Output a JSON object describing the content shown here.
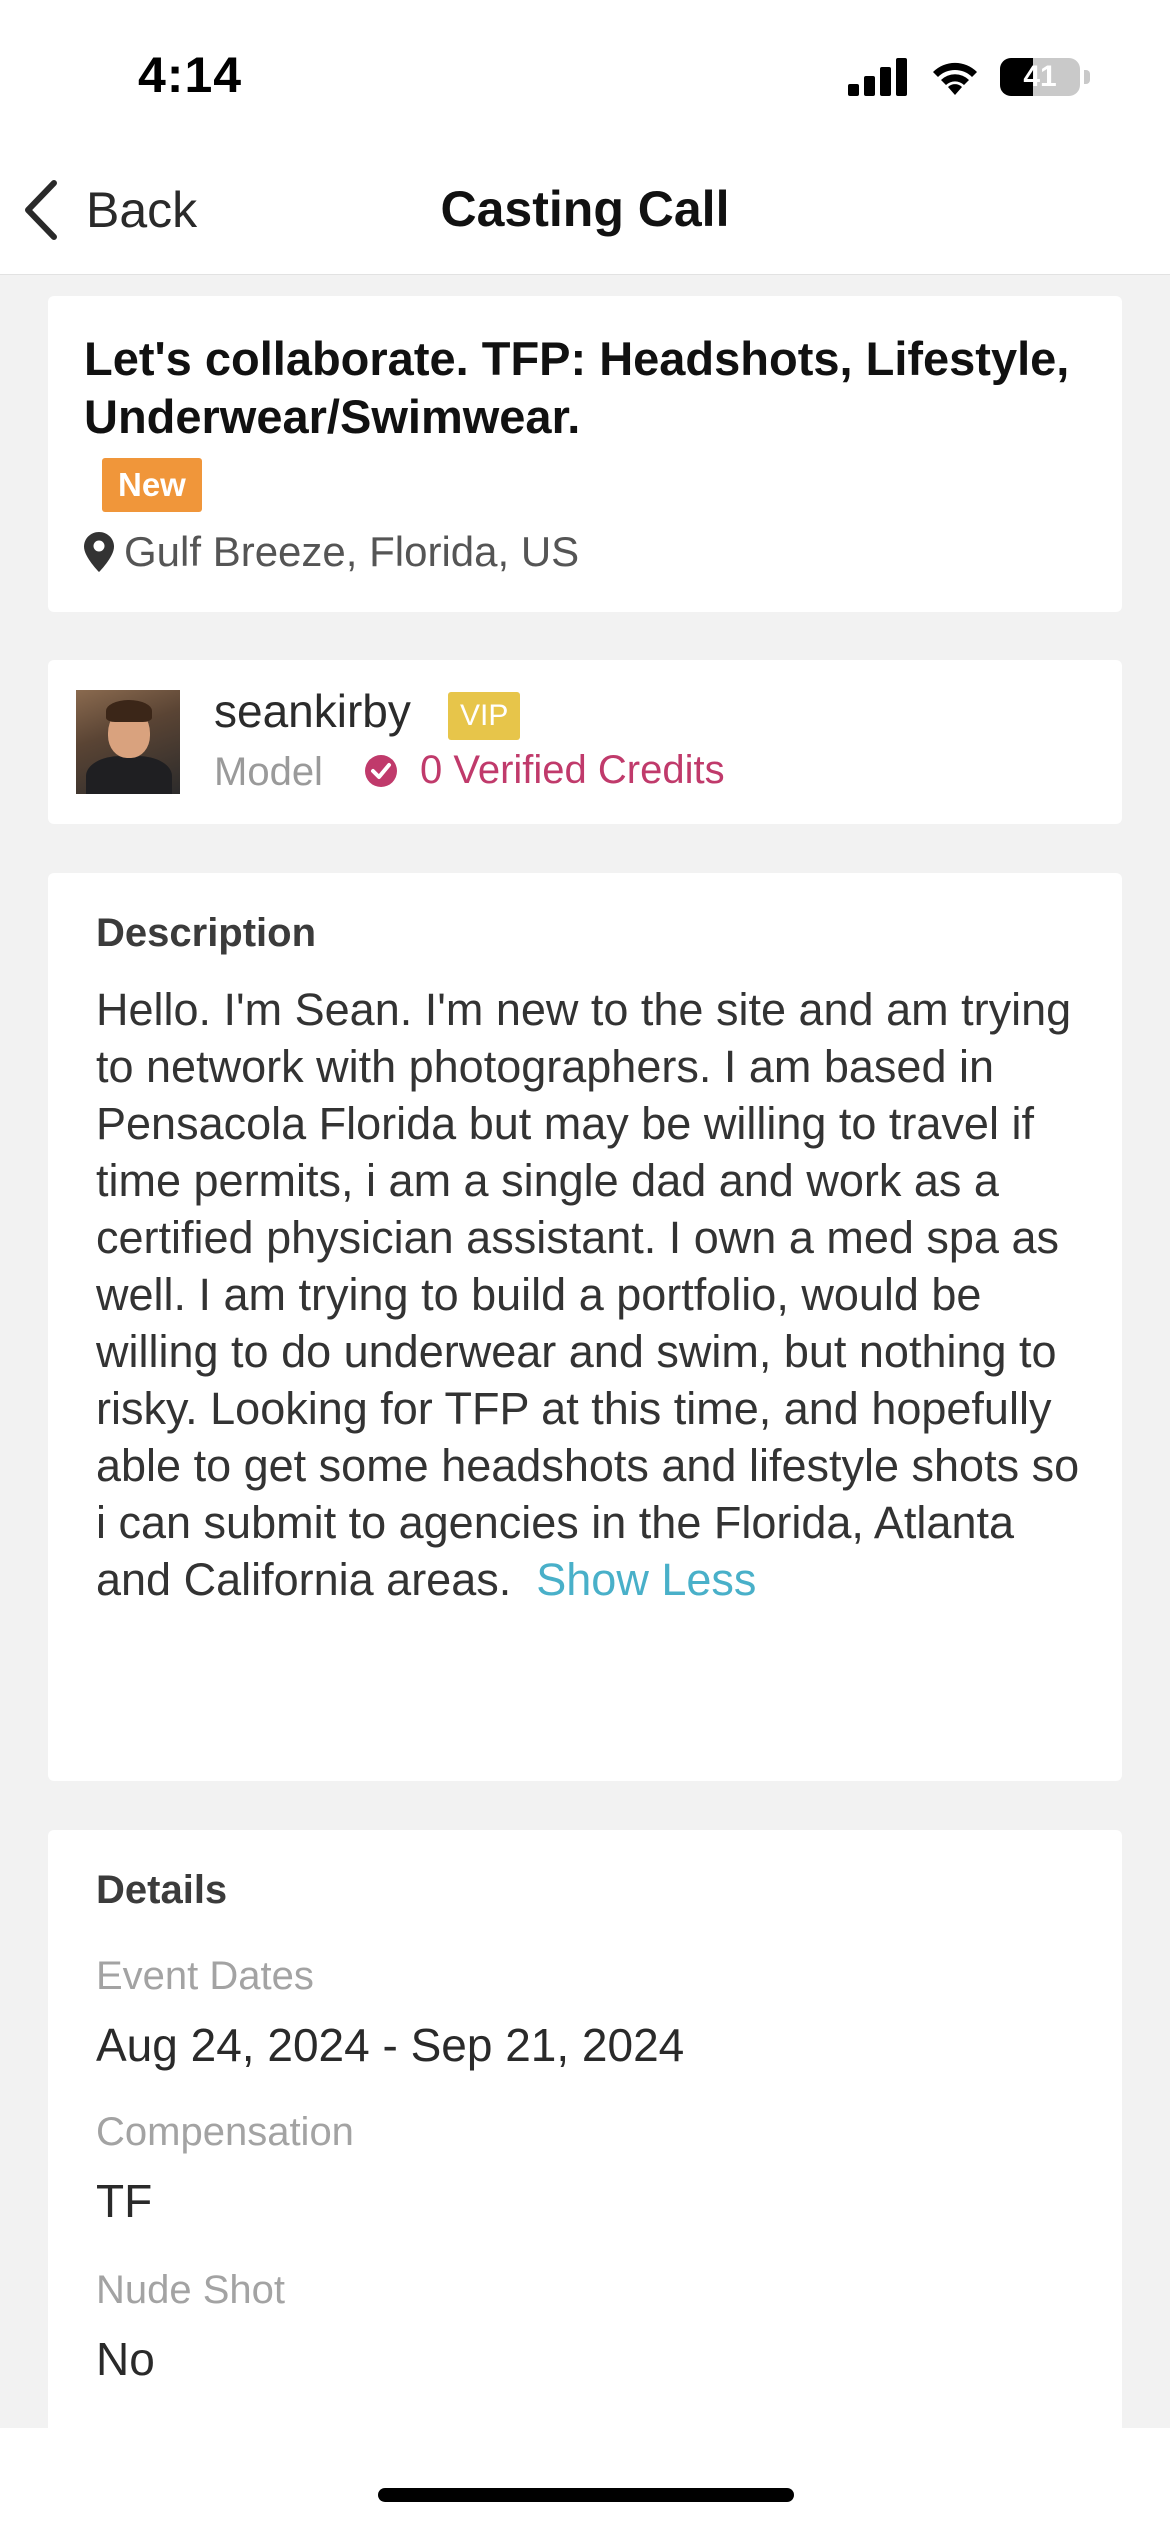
{
  "status_bar": {
    "time": "4:14",
    "battery_percent": "41",
    "icons": [
      "signal-icon",
      "wifi-icon",
      "battery-icon"
    ]
  },
  "nav": {
    "back_label": "Back",
    "title": "Casting Call"
  },
  "listing": {
    "title": "Let's collaborate. TFP: Headshots, Lifestyle, Underwear/Swimwear.",
    "badge": "New",
    "location": "Gulf Breeze, Florida, US"
  },
  "profile": {
    "username": "seankirby",
    "badge": "VIP",
    "role": "Model",
    "credits": "0 Verified Credits"
  },
  "description": {
    "heading": "Description",
    "text": "Hello. I'm Sean. I'm new to the site and am trying to network with photographers. I am based in Pensacola Florida but may be willing to travel if time permits, i am a single dad and work as a certified physician assistant. I own a med spa as well. I am trying to build a portfolio, would be willing to do underwear and swim, but nothing to risky. Looking for TFP at this time, and hopefully able to get some headshots and lifestyle shots so i can submit to agencies in the Florida, Atlanta and California areas.",
    "toggle_label": "Show Less"
  },
  "details": {
    "heading": "Details",
    "items": [
      {
        "label": "Event Dates",
        "value": "Aug 24, 2024 - Sep 21, 2024"
      },
      {
        "label": "Compensation",
        "value": "TF"
      },
      {
        "label": "Nude Shot",
        "value": "No"
      }
    ]
  },
  "colors": {
    "badge_new": "#f0963a",
    "badge_vip": "#e7c54a",
    "credits": "#c03a6b",
    "link": "#49b0c9"
  }
}
